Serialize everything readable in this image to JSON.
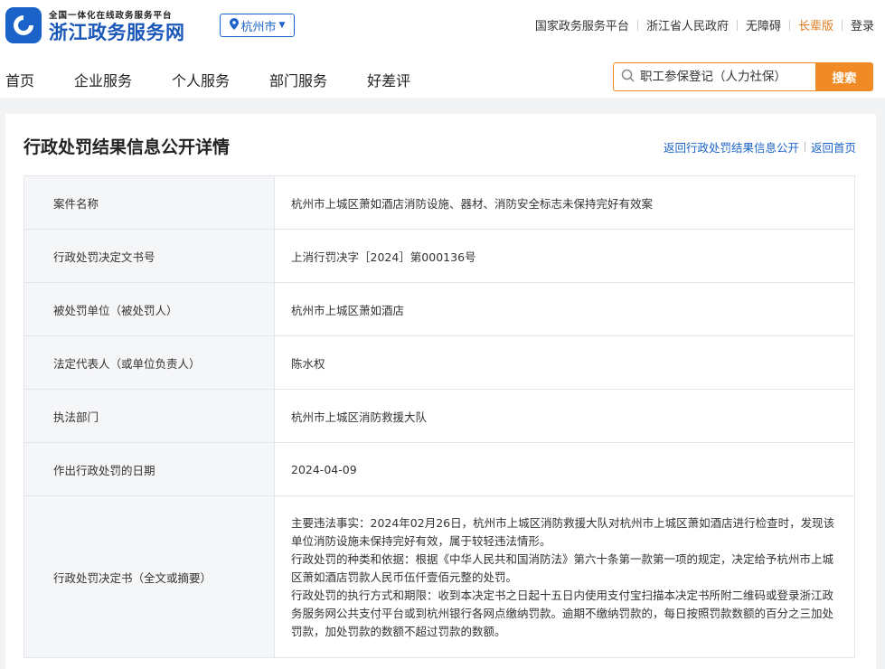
{
  "header": {
    "logo_subtitle": "全国一体化在线政务服务平台",
    "logo_title": "浙江政务服务网",
    "city_selector": "杭州市",
    "top_links": [
      "国家政务服务平台",
      "浙江省人民政府",
      "无障碍",
      "长辈版",
      "登录"
    ],
    "nav_items": [
      "首页",
      "企业服务",
      "个人服务",
      "部门服务",
      "好差评"
    ],
    "search_placeholder": "职工参保登记（人力社保）",
    "search_button": "搜索"
  },
  "detail": {
    "title": "行政处罚结果信息公开详情",
    "back_links": [
      "返回行政处罚结果信息公开",
      "返回首页"
    ],
    "rows": [
      {
        "label": "案件名称",
        "value": "杭州市上城区萧如酒店消防设施、器材、消防安全标志未保持完好有效案"
      },
      {
        "label": "行政处罚决定文书号",
        "value": "上消行罚决字［2024］第000136号"
      },
      {
        "label": "被处罚单位（被处罚人）",
        "value": "杭州市上城区萧如酒店"
      },
      {
        "label": "法定代表人（或单位负责人）",
        "value": "陈水权"
      },
      {
        "label": "执法部门",
        "value": "杭州市上城区消防救援大队"
      },
      {
        "label": "作出行政处罚的日期",
        "value": "2024-04-09"
      },
      {
        "label": "行政处罚决定书（全文或摘要）",
        "value": "主要违法事实：2024年02月26日，杭州市上城区消防救援大队对杭州市上城区萧如酒店进行检查时，发现该单位消防设施未保持完好有效，属于较轻违法情形。\n行政处罚的种类和依据：根据《中华人民共和国消防法》第六十条第一款第一项的规定，决定给予杭州市上城区萧如酒店罚款人民币伍仟壹佰元整的处罚。\n行政处罚的执行方式和期限：收到本决定书之日起十五日内使用支付宝扫描本决定书所附二维码或登录浙江政务服务网公共支付平台或到杭州银行各网点缴纳罚款。逾期不缴纳罚款的，每日按照罚款数额的百分之三加处罚款，加处罚款的数额不超过罚款的数额。"
      }
    ]
  },
  "colors": {
    "brand_blue": "#1c63c9",
    "accent_orange": "#f08a24"
  }
}
